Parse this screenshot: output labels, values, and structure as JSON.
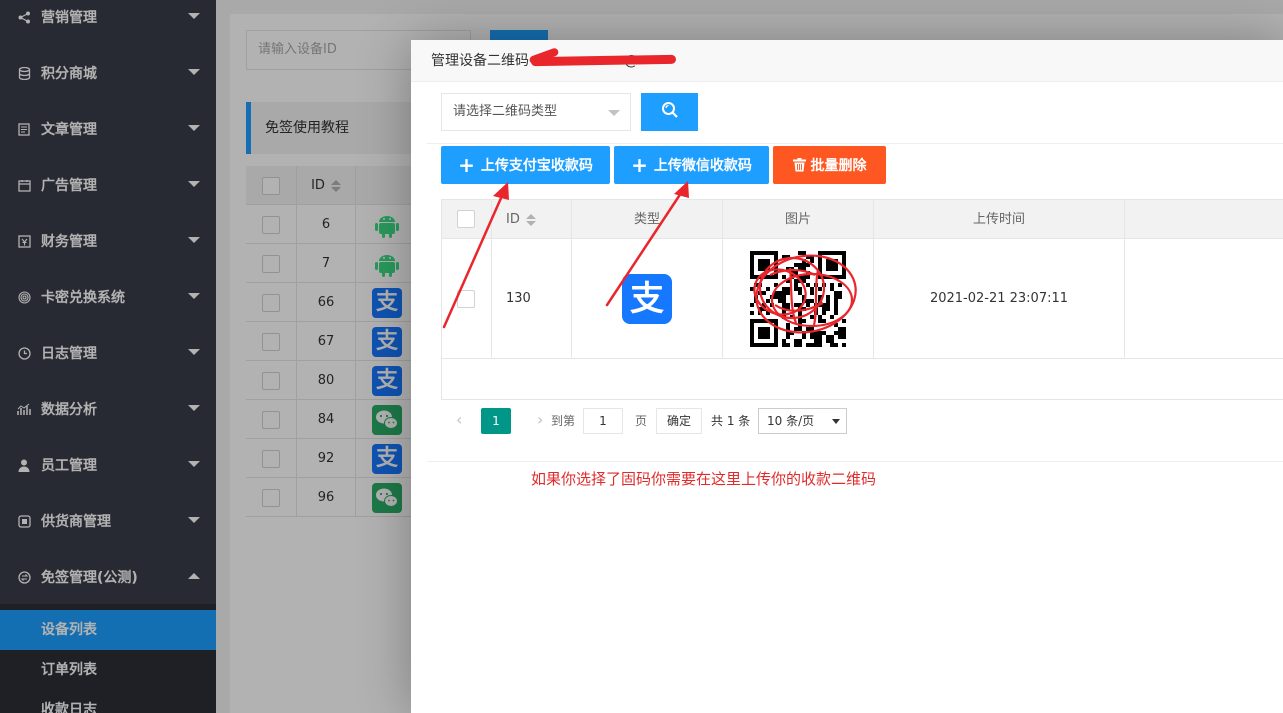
{
  "sidebar": {
    "items": [
      {
        "label": "营销管理",
        "icon": "share-icon"
      },
      {
        "label": "积分商城",
        "icon": "database-icon"
      },
      {
        "label": "文章管理",
        "icon": "document-icon"
      },
      {
        "label": "广告管理",
        "icon": "calendar-icon"
      },
      {
        "label": "财务管理",
        "icon": "wallet-icon"
      },
      {
        "label": "卡密兑换系统",
        "icon": "fingerprint-icon"
      },
      {
        "label": "日志管理",
        "icon": "clock-icon"
      },
      {
        "label": "数据分析",
        "icon": "chart-icon"
      },
      {
        "label": "员工管理",
        "icon": "user-icon"
      },
      {
        "label": "供货商管理",
        "icon": "supplier-icon"
      },
      {
        "label": "免签管理(公测)",
        "icon": "exchange-icon"
      }
    ],
    "sub_items": [
      {
        "label": "设备列表",
        "active": true
      },
      {
        "label": "订单列表",
        "active": false
      },
      {
        "label": "收款日志",
        "active": false
      }
    ]
  },
  "background_page": {
    "device_id_placeholder": "请输入设备ID",
    "notice": "免签使用教程",
    "id_header": "ID",
    "rows": [
      {
        "id": "6",
        "type": "android"
      },
      {
        "id": "7",
        "type": "android"
      },
      {
        "id": "66",
        "type": "alipay"
      },
      {
        "id": "67",
        "type": "alipay"
      },
      {
        "id": "80",
        "type": "alipay"
      },
      {
        "id": "84",
        "type": "wechat"
      },
      {
        "id": "92",
        "type": "alipay"
      },
      {
        "id": "96",
        "type": "wechat"
      }
    ]
  },
  "modal": {
    "title": "管理设备二维码-",
    "title_tail": "@",
    "type_select_placeholder": "请选择二维码类型",
    "buttons": {
      "upload_alipay": "上传支付宝收款码",
      "upload_wechat": "上传微信收款码",
      "batch_delete": "批量删除"
    },
    "table": {
      "headers": {
        "id": "ID",
        "type": "类型",
        "image": "图片",
        "upload_time": "上传时间"
      },
      "rows": [
        {
          "id": "130",
          "type": "alipay",
          "upload_time": "2021-02-21 23:07:11"
        }
      ]
    },
    "pagination": {
      "current_page": "1",
      "goto_label": "到第",
      "goto_value": "1",
      "page_unit": "页",
      "confirm": "确定",
      "total": "共 1 条",
      "page_size": "10 条/页"
    }
  },
  "annotation_note": "如果你选择了固码你需要在这里上传你的收款二维码",
  "colors": {
    "sidebar_bg": "#393d49",
    "primary": "#1e9fff",
    "danger": "#ff5722",
    "pager_active": "#009688",
    "annotation": "#e02b2b"
  }
}
